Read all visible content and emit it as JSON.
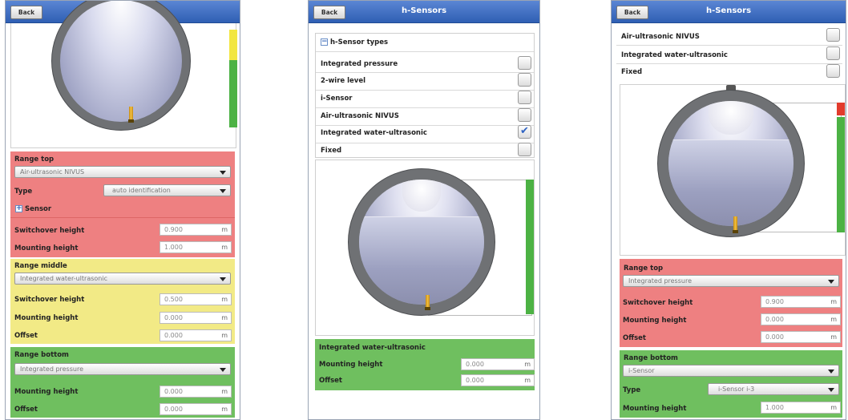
{
  "header": {
    "back_label": "Back",
    "title": "h-Sensors"
  },
  "colors": {
    "red": "#ee8081",
    "yellow": "#f2ea86",
    "green": "#6fbf5f",
    "header_blue": "#3d6cc0"
  },
  "screen1": {
    "range_top": {
      "title": "Range top",
      "sensor_select": "Air-ultrasonic NIVUS",
      "type_label": "Type",
      "type_select": "auto identification",
      "sensor_expander": "Sensor",
      "switchover_label": "Switchover height",
      "switchover_value": "0.900",
      "mounting_label": "Mounting height",
      "mounting_value": "1.000",
      "unit": "m"
    },
    "range_middle": {
      "title": "Range middle",
      "sensor_select": "Integrated water-ultrasonic",
      "switchover_label": "Switchover height",
      "switchover_value": "0.500",
      "mounting_label": "Mounting height",
      "mounting_value": "0.000",
      "offset_label": "Offset",
      "offset_value": "0.000",
      "unit": "m"
    },
    "range_bottom": {
      "title": "Range bottom",
      "sensor_select": "Integrated pressure",
      "mounting_label": "Mounting height",
      "mounting_value": "0.000",
      "offset_label": "Offset",
      "offset_value": "0.000",
      "unit": "m"
    }
  },
  "screen2": {
    "types_header": "h-Sensor types",
    "types": [
      {
        "label": "Integrated pressure",
        "checked": false
      },
      {
        "label": "2-wire level",
        "checked": false
      },
      {
        "label": "i-Sensor",
        "checked": false
      },
      {
        "label": "Air-ultrasonic NIVUS",
        "checked": false
      },
      {
        "label": "Integrated water-ultrasonic",
        "checked": true
      },
      {
        "label": "Fixed",
        "checked": false
      }
    ],
    "sensor_panel": {
      "title": "Integrated water-ultrasonic",
      "mounting_label": "Mounting height",
      "mounting_value": "0.000",
      "offset_label": "Offset",
      "offset_value": "0.000",
      "unit": "m"
    }
  },
  "screen3": {
    "types": [
      {
        "label": "Air-ultrasonic NIVUS",
        "checked": false
      },
      {
        "label": "Integrated water-ultrasonic",
        "checked": false
      },
      {
        "label": "Fixed",
        "checked": false
      }
    ],
    "range_top": {
      "title": "Range top",
      "sensor_select": "Integrated pressure",
      "switchover_label": "Switchover height",
      "switchover_value": "0.900",
      "mounting_label": "Mounting height",
      "mounting_value": "0.000",
      "offset_label": "Offset",
      "offset_value": "0.000",
      "unit": "m"
    },
    "range_bottom": {
      "title": "Range bottom",
      "sensor_select": "i-Sensor",
      "type_label": "Type",
      "type_select": "i-Sensor i-3",
      "mounting_label": "Mounting height",
      "mounting_value": "1.000",
      "unit": "m"
    }
  }
}
